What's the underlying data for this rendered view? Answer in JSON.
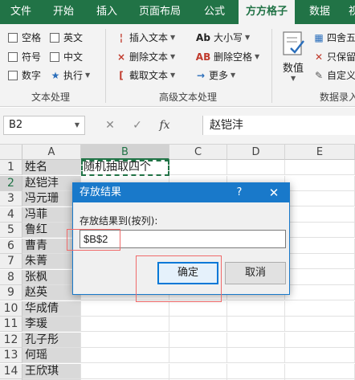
{
  "ribbon_tabs": [
    "文件",
    "开始",
    "插入",
    "页面布局",
    "公式",
    "方方格子",
    "数据",
    "视"
  ],
  "ribbon": {
    "text_group": {
      "checkboxes": [
        "空格",
        "英文",
        "符号",
        "中文",
        "数字"
      ],
      "exec_label": "执行",
      "label": "文本处理"
    },
    "advanced_group": {
      "buttons": [
        "插入文本",
        "删除文本",
        "截取文本"
      ],
      "right_buttons": [
        "大小写",
        "删除空格",
        "更多"
      ],
      "label": "高级文本处理"
    },
    "data_group": {
      "big_button": "数值",
      "buttons": [
        "四舍五",
        "只保留",
        "自定义"
      ],
      "label": "数据录入"
    }
  },
  "formula_bar": {
    "name_box": "B2",
    "fx": "fx",
    "content": "赵铠沣"
  },
  "grid": {
    "columns": [
      "A",
      "B",
      "C",
      "D",
      "E"
    ],
    "rows": [
      "1",
      "2",
      "3",
      "4",
      "5",
      "6",
      "7",
      "8",
      "9",
      "10",
      "11",
      "12",
      "13",
      "14",
      "15"
    ],
    "col_a": [
      "姓名",
      "赵铠沣",
      "冯元珊",
      "冯菲",
      "鲁红",
      "曹青",
      "朱菁",
      "张枫",
      "赵英",
      "华成倩",
      "李瑗",
      "孔子彤",
      "何瑶",
      "王欣琪",
      "朱倩"
    ],
    "b1": "随机抽取四个"
  },
  "dialog": {
    "title": "存放结果",
    "help": "?",
    "close": "✕",
    "label": "存放结果到(按列):",
    "value": "$B$2",
    "ok": "确定",
    "cancel": "取消"
  }
}
